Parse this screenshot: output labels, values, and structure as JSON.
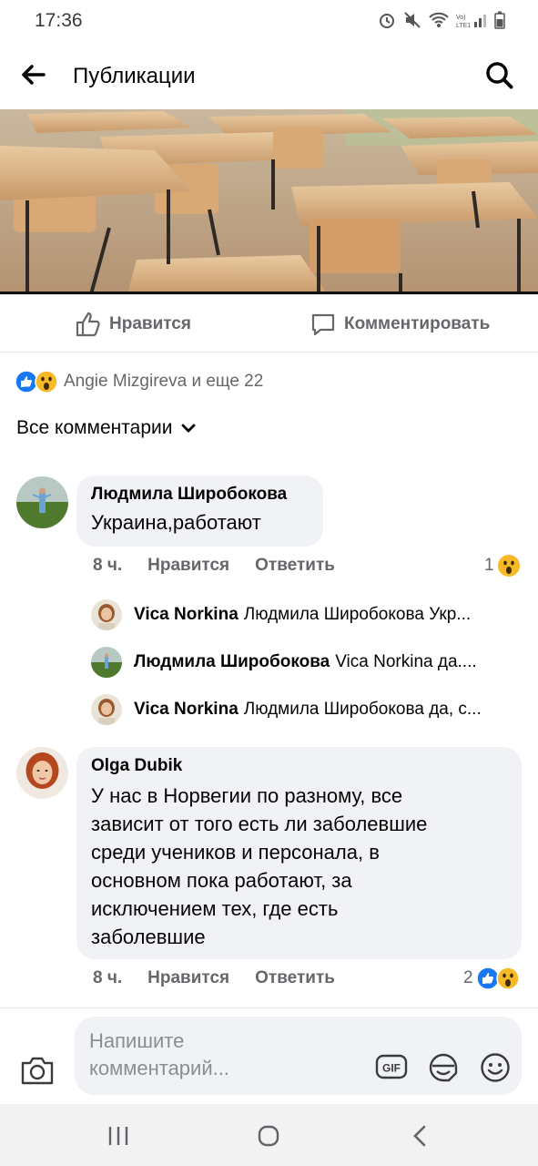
{
  "status": {
    "time": "17:36"
  },
  "header": {
    "title": "Публикации"
  },
  "actions": {
    "like_label": "Нравится",
    "comment_label": "Комментировать"
  },
  "reactions": {
    "summary": "Angie Mizgireva и еще 22"
  },
  "comments_filter": {
    "label": "Все комментарии"
  },
  "comments": [
    {
      "author": "Людмила Широбокова",
      "text": "Украина,работают",
      "time": "8 ч.",
      "like_label": "Нравится",
      "reply_label": "Ответить",
      "reaction_count": "1",
      "replies": [
        {
          "author": "Vica Norkina",
          "text": "Людмила Широбокова Укр..."
        },
        {
          "author": "Людмила Широбокова",
          "text": "Vica Norkina да...."
        },
        {
          "author": "Vica Norkina",
          "text": "Людмила Широбокова да, с..."
        }
      ]
    },
    {
      "author": "Olga Dubik",
      "text_lines": [
        "У нас в Норвегии по разному, все",
        "зависит от того есть ли заболевшие",
        "среди учеников и персонала, в",
        "основном пока работают, за",
        "исключением тех, где есть",
        "заболевшие"
      ],
      "time": "8 ч.",
      "like_label": "Нравится",
      "reply_label": "Ответить",
      "reaction_count": "2"
    }
  ],
  "composer": {
    "placeholder_line1": "Напишите",
    "placeholder_line2": "комментарий...",
    "gif_label": "GIF"
  },
  "colors": {
    "like_blue": "#1877f2",
    "wow_yellow": "#f7b928",
    "meta_gray": "#65676b",
    "bubble_bg": "#f0f2f5"
  }
}
